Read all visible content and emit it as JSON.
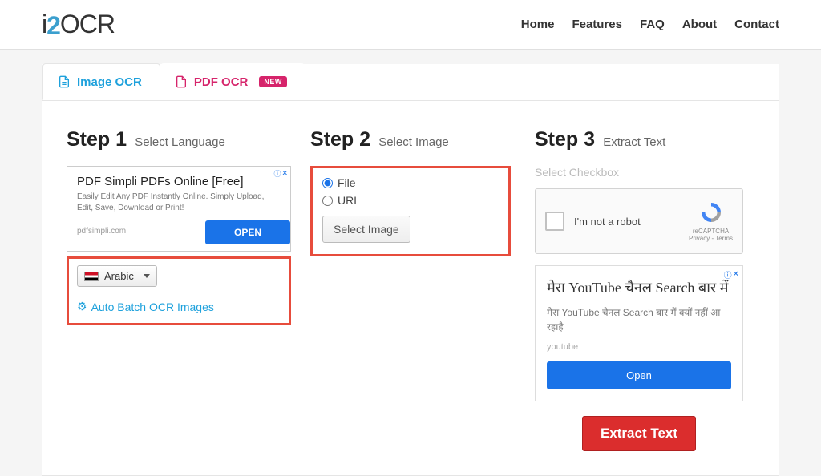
{
  "header": {
    "logo": {
      "i": "i",
      "two": "2",
      "ocr": "OCR"
    },
    "nav": [
      "Home",
      "Features",
      "FAQ",
      "About",
      "Contact"
    ]
  },
  "tabs": {
    "image_ocr": "Image OCR",
    "pdf_ocr": "PDF OCR",
    "new_badge": "NEW"
  },
  "step1": {
    "num": "Step 1",
    "label": "Select Language",
    "ad": {
      "title": "PDF Simpli PDFs Online [Free]",
      "sub": "Easily Edit Any PDF Instantly Online. Simply Upload, Edit, Save, Download or Print!",
      "domain": "pdfsimpli.com",
      "btn": "OPEN",
      "info": "ⓘ",
      "close": "✕"
    },
    "language": "Arabic",
    "auto_batch": "Auto Batch OCR Images"
  },
  "step2": {
    "num": "Step 2",
    "label": "Select Image",
    "opt_file": "File",
    "opt_url": "URL",
    "select_btn": "Select Image"
  },
  "step3": {
    "num": "Step 3",
    "label": "Extract Text",
    "sub": "Select Checkbox",
    "captcha_label": "I'm not a robot",
    "captcha_brand": "reCAPTCHA",
    "captcha_terms": "Privacy - Terms",
    "ad": {
      "title": "मेरा YouTube चैनल Search बार में",
      "sub": "मेरा YouTube चैनल Search बार में क्यों नहीं आ रहाहै",
      "domain": "youtube",
      "btn": "Open",
      "info": "ⓘ",
      "close": "✕"
    },
    "extract_btn": "Extract Text"
  }
}
